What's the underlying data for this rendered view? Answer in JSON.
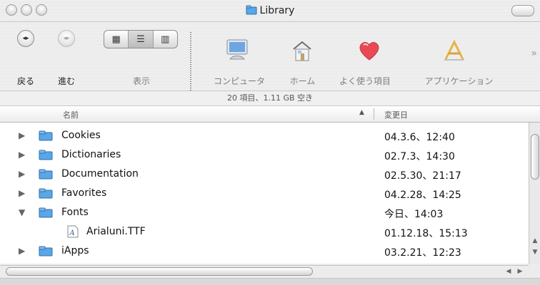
{
  "window": {
    "title": "Library",
    "icons": {
      "title_folder": "folder-icon",
      "close": "close-button",
      "minimize": "minimize-button",
      "zoom": "zoom-button",
      "toolbar_toggle": "toolbar-toggle-pill"
    }
  },
  "toolbar": {
    "back_label": "戻る",
    "forward_label": "進む",
    "view_label": "表示",
    "view_modes": [
      "icon-view",
      "list-view",
      "column-view"
    ],
    "active_view_index": 1,
    "places": [
      {
        "label": "コンピュータ",
        "icon": "computer-icon"
      },
      {
        "label": "ホーム",
        "icon": "home-icon"
      },
      {
        "label": "よく使う項目",
        "icon": "heart-icon"
      },
      {
        "label": "アプリケーション",
        "icon": "applications-icon"
      }
    ],
    "overflow_glyph": "»"
  },
  "status": {
    "text": "20 項目、1.11 GB 空き"
  },
  "list": {
    "headers": {
      "name": "名前",
      "date": "変更日",
      "sort_indicator": "▲"
    },
    "rows": [
      {
        "name": "Cookies",
        "date": "04.3.6、12:40",
        "expanded": false,
        "kind": "folder"
      },
      {
        "name": "Dictionaries",
        "date": "02.7.3、14:30",
        "expanded": false,
        "kind": "folder"
      },
      {
        "name": "Documentation",
        "date": "02.5.30、21:17",
        "expanded": false,
        "kind": "folder"
      },
      {
        "name": "Favorites",
        "date": "04.2.28、14:25",
        "expanded": false,
        "kind": "folder"
      },
      {
        "name": "Fonts",
        "date": "今日、14:03",
        "expanded": true,
        "kind": "folder"
      },
      {
        "name": "Arialuni.TTF",
        "date": "01.12.18、15:13",
        "expanded": null,
        "kind": "font-file"
      },
      {
        "name": "iApps",
        "date": "03.2.21、12:23",
        "expanded": false,
        "kind": "folder"
      }
    ]
  },
  "colors": {
    "folder_blue": "#5aa6e6",
    "heart_red": "#e84a55",
    "selection_none": "#ffffff"
  }
}
